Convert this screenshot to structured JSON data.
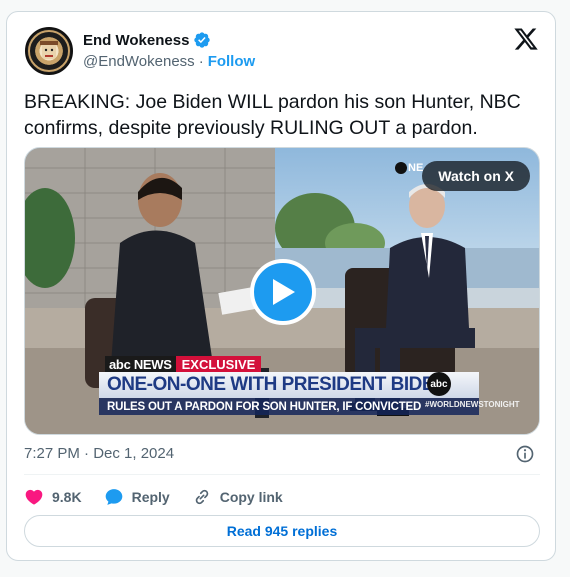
{
  "author": {
    "name": "End Wokeness",
    "handle": "@EndWokeness",
    "separator": "·",
    "follow_label": "Follow",
    "avatar_icon": "end-wokeness-logo",
    "verified_color": "#1d9bf0"
  },
  "tweet": {
    "text": "BREAKING: Joe Biden WILL pardon his son Hunter, NBC confirms, despite previously RULING OUT a pardon."
  },
  "video": {
    "watch_label": "Watch on X",
    "corner_logo": "NE",
    "chyron_brand": "abc NEWS",
    "chyron_tag": "EXCLUSIVE",
    "chyron_main": "ONE-ON-ONE WITH PRESIDENT BIDEN",
    "chyron_sub": "RULES OUT A PARDON FOR SON HUNTER, IF CONVICTED",
    "network_badge": "abc",
    "hashtag": "#WORLDNEWSTONIGHT"
  },
  "meta": {
    "timestamp": "7:27 PM · Dec 1, 2024"
  },
  "actions": {
    "likes": "9.8K",
    "reply_label": "Reply",
    "copy_label": "Copy link",
    "like_color": "#f91880",
    "reply_color": "#1d9bf0"
  },
  "replies_button": "Read 945 replies",
  "colors": {
    "accent": "#1d9bf0",
    "border": "#cfd9de",
    "text_secondary": "#536471"
  }
}
